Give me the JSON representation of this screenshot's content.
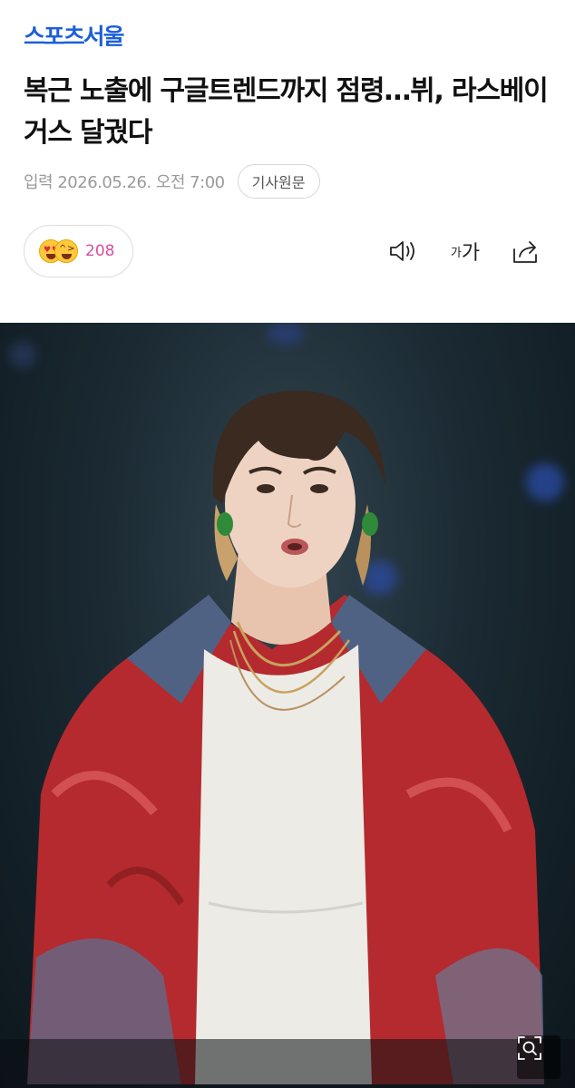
{
  "header": {
    "logo_text": "스포츠서울",
    "brand_color": "#1c5fd6"
  },
  "article": {
    "headline": "복근 노출에 구글트렌드까지 점령…뷔, 라스베이거스 달궜다",
    "date": "입력 2026.05.26. 오전 7:00",
    "source_button": "기사원문"
  },
  "toolbar": {
    "reaction_count": "208",
    "reaction_icons": [
      "heart-eyes-emoji-icon",
      "laughing-emoji-icon"
    ],
    "speaker_icon": "speaker-icon",
    "font_small": "가",
    "font_big": "가",
    "share_icon": "share-icon"
  },
  "media": {
    "image_icon": "zoom-icon"
  }
}
